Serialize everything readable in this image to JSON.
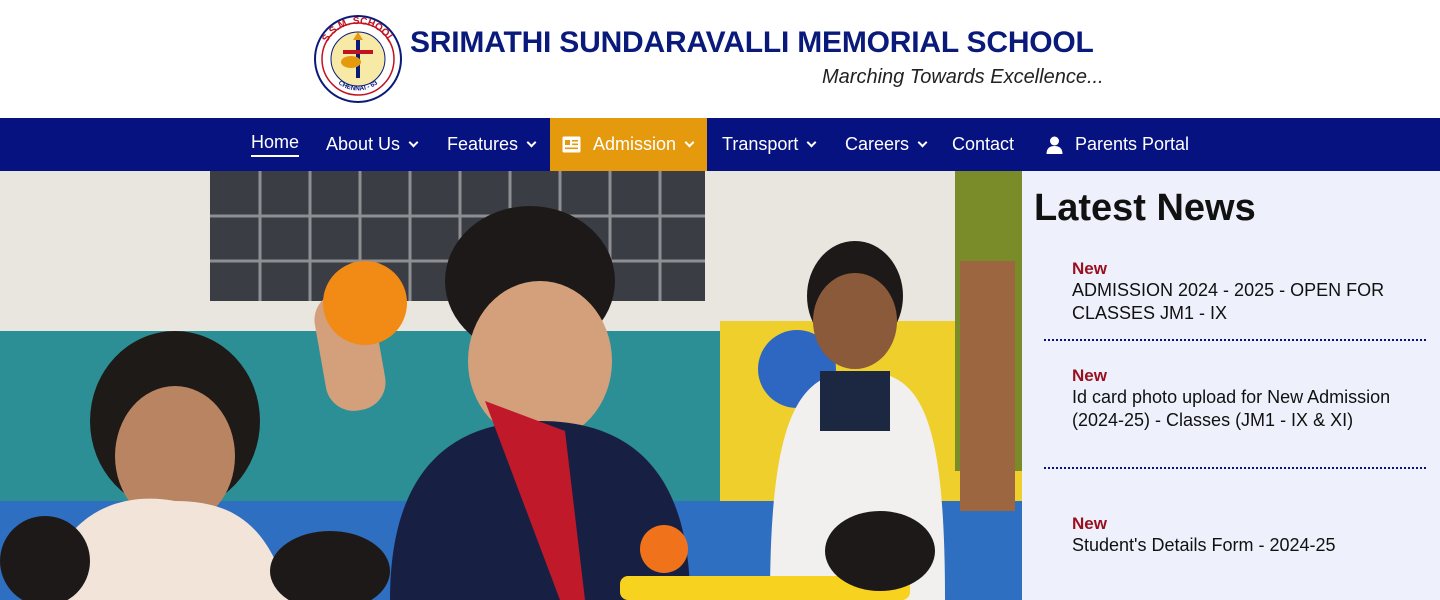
{
  "header": {
    "school_name": "SRIMATHI SUNDARAVALLI MEMORIAL SCHOOL",
    "tagline": "Marching Towards Excellence...",
    "logo": {
      "top_text": "S.S.M. SCHOOL",
      "bottom_text": "CHENNAI - 63"
    }
  },
  "nav": {
    "items": [
      {
        "label": "Home",
        "active": true
      },
      {
        "label": "About Us",
        "dropdown": true
      },
      {
        "label": "Features",
        "dropdown": true
      },
      {
        "label": "Admission",
        "dropdown": true,
        "highlight": true,
        "icon": "id-card-icon"
      },
      {
        "label": "Transport",
        "dropdown": true
      },
      {
        "label": "Careers",
        "dropdown": true
      },
      {
        "label": "Contact"
      },
      {
        "label": "Parents Portal",
        "icon": "user-icon"
      }
    ]
  },
  "news": {
    "title": "Latest News",
    "items": [
      {
        "tag": "New",
        "text": "ADMISSION 2024 - 2025 - OPEN FOR CLASSES JM1 - IX"
      },
      {
        "tag": "New",
        "text": "Id card photo upload for New Admission (2024-25) - Classes (JM1 - IX & XI)"
      },
      {
        "tag": "New",
        "text": "Student's Details Form - 2024-25"
      }
    ]
  },
  "colors": {
    "nav_bg": "#071281",
    "brand": "#0a1a7a",
    "admission_highlight": "#e59a0e",
    "news_tag": "#9a0f1f",
    "news_bg": "#eef1fb"
  }
}
